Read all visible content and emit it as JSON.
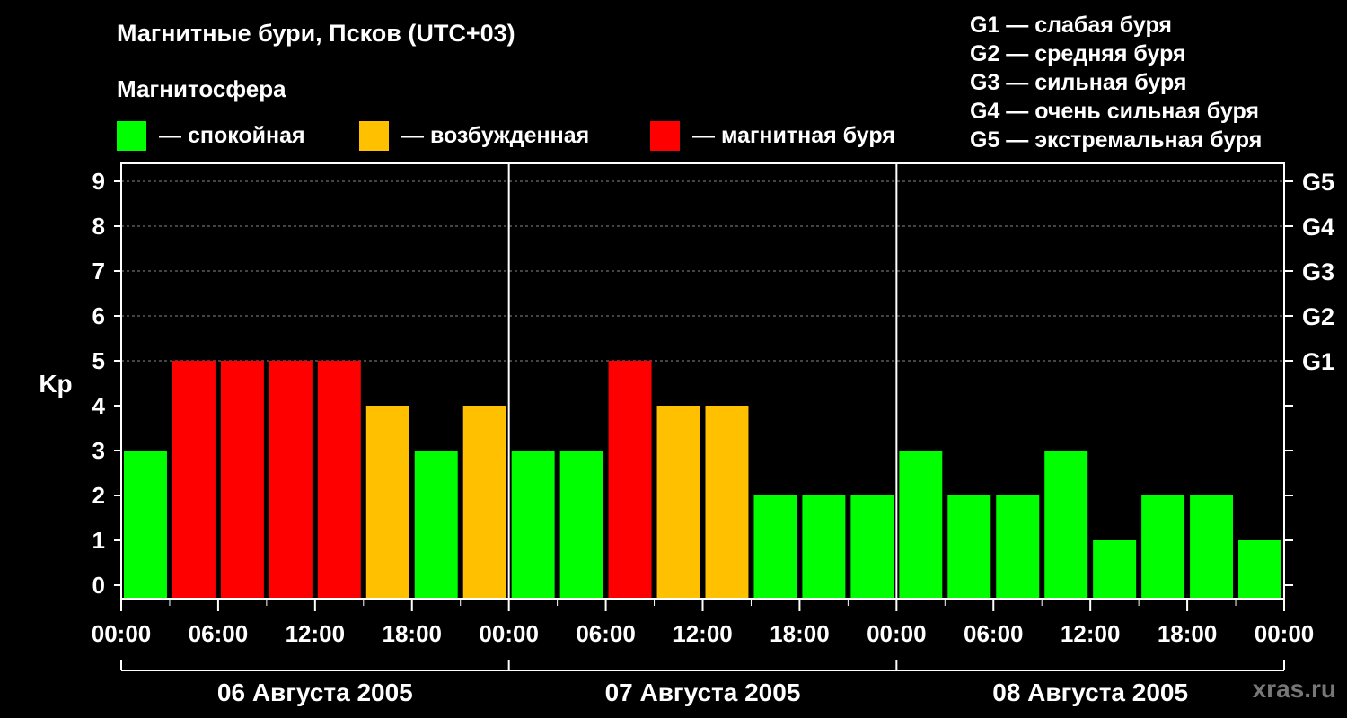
{
  "title": "Магнитные бури, Псков (UTC+03)",
  "legend": {
    "heading": "Магнитосфера",
    "items": [
      {
        "label": "— спокойная",
        "color": "#00ff00"
      },
      {
        "label": "— возбужденная",
        "color": "#ffc000"
      },
      {
        "label": "— магнитная буря",
        "color": "#ff0000"
      }
    ]
  },
  "g_legend": [
    "G1 — слабая буря",
    "G2 — средняя буря",
    "G3 — сильная буря",
    "G4 — очень сильная буря",
    "G5 — экстремальная буря"
  ],
  "watermark": "xras.ru",
  "chart_data": {
    "type": "bar",
    "ylabel": "Kp",
    "ylim": [
      0,
      9
    ],
    "yticks": [
      "0",
      "1",
      "2",
      "3",
      "4",
      "5",
      "6",
      "7",
      "8",
      "9"
    ],
    "right_axis_labels": [
      {
        "kp": 5,
        "label": "G1"
      },
      {
        "kp": 6,
        "label": "G2"
      },
      {
        "kp": 7,
        "label": "G3"
      },
      {
        "kp": 8,
        "label": "G4"
      },
      {
        "kp": 9,
        "label": "G5"
      }
    ],
    "x_tick_labels": [
      "00:00",
      "06:00",
      "12:00",
      "18:00",
      "00:00",
      "06:00",
      "12:00",
      "18:00",
      "00:00",
      "06:00",
      "12:00",
      "18:00",
      "00:00"
    ],
    "days": [
      "06 Августа 2005",
      "07 Августа 2005",
      "08 Августа 2005"
    ],
    "interval_hours": 3,
    "values": [
      3,
      5,
      5,
      5,
      5,
      4,
      3,
      4,
      3,
      3,
      5,
      4,
      4,
      2,
      2,
      2,
      3,
      2,
      2,
      3,
      1,
      2,
      2,
      1
    ],
    "colors_by_level": {
      "quiet": "#00ff00",
      "active": "#ffc000",
      "storm": "#ff0000"
    },
    "thresholds": {
      "active_min": 4,
      "storm_min": 5
    },
    "grid": true
  }
}
